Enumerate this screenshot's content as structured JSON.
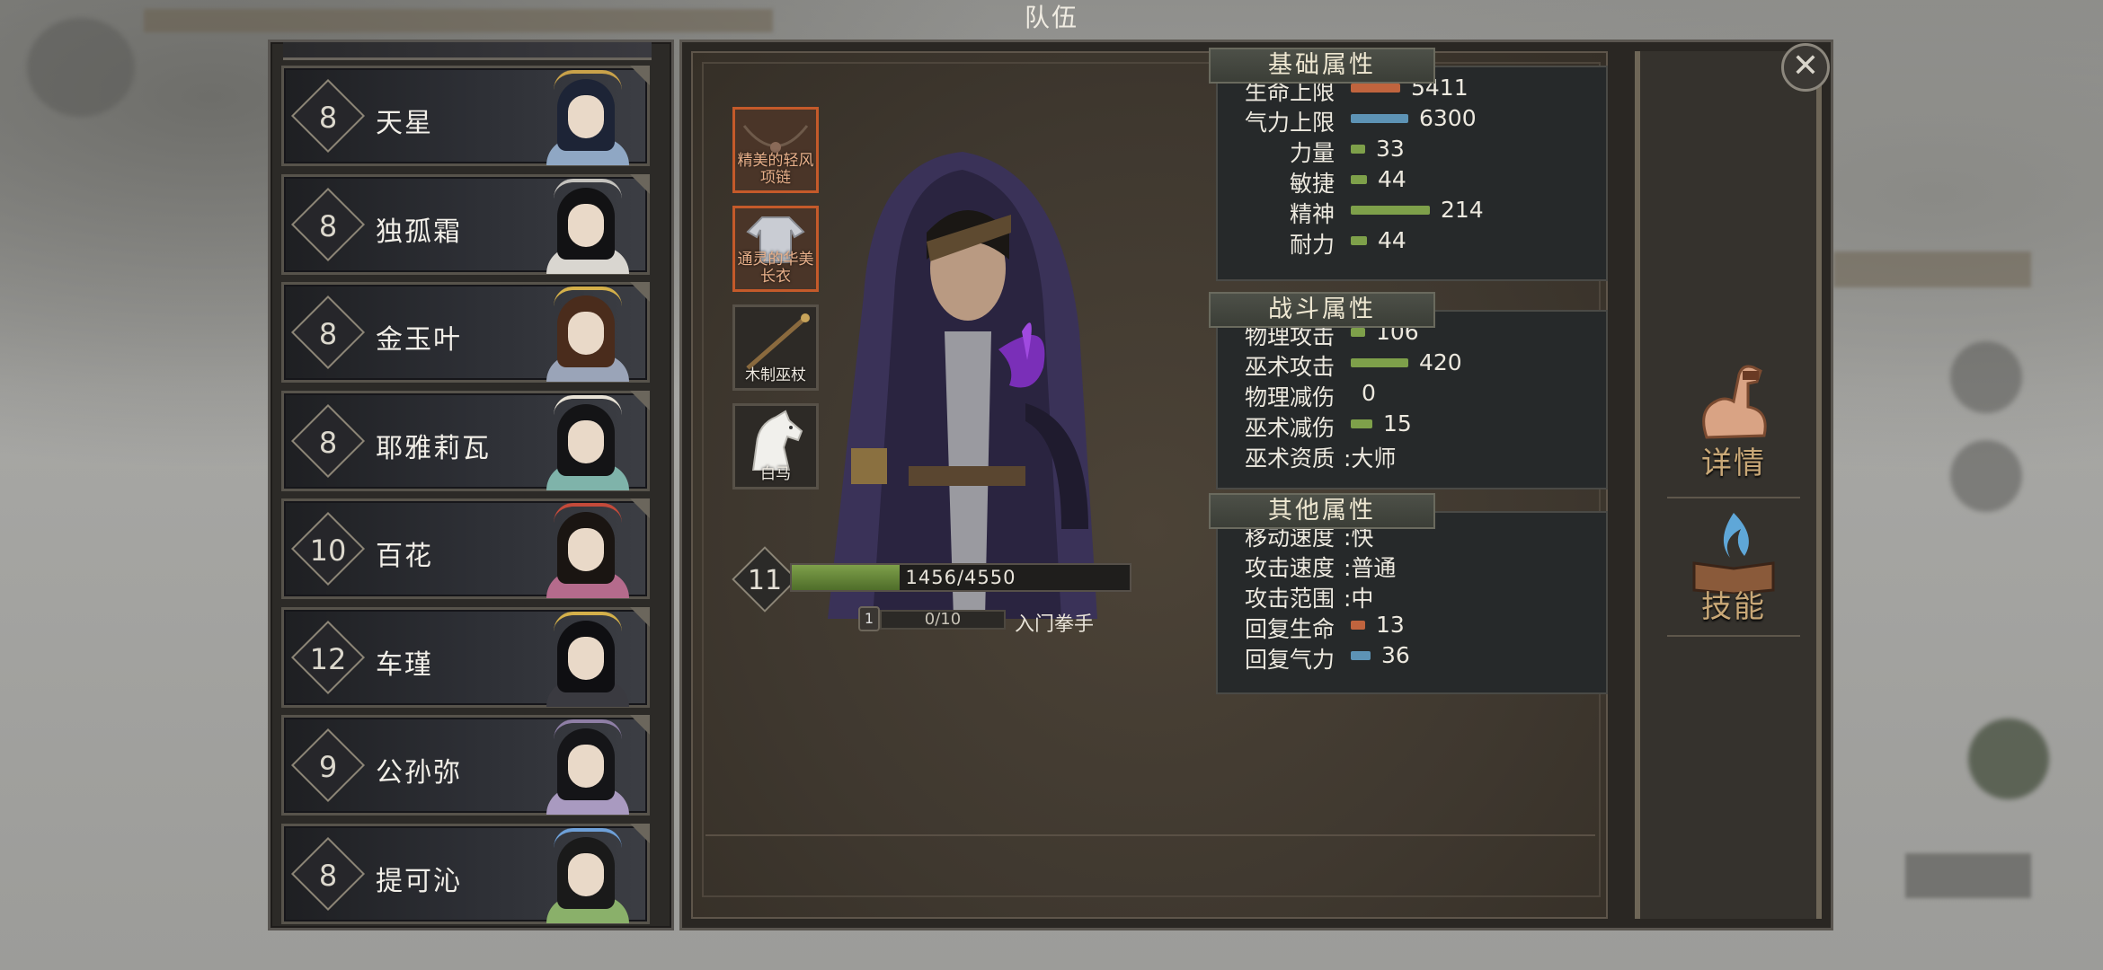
{
  "window": {
    "title": "队伍"
  },
  "roster": [
    {
      "level": "8",
      "name": "天星",
      "hair": "#1d2436",
      "robe": "#8fa7c4",
      "accent": "#c9a24a"
    },
    {
      "level": "8",
      "name": "独孤霜",
      "hair": "#121214",
      "robe": "#d9d6d0",
      "accent": "#c4c2bd"
    },
    {
      "level": "8",
      "name": "金玉叶",
      "hair": "#4a2c1c",
      "robe": "#9aa4b8",
      "accent": "#d4b04a"
    },
    {
      "level": "8",
      "name": "耶雅莉瓦",
      "hair": "#141416",
      "robe": "#7fb3aa",
      "accent": "#e8e2d6"
    },
    {
      "level": "10",
      "name": "百花",
      "hair": "#1a1512",
      "robe": "#b56b8c",
      "accent": "#c44a3a"
    },
    {
      "level": "12",
      "name": "车瑾",
      "hair": "#0f0f12",
      "robe": "#3a3a40",
      "accent": "#d4b04a"
    },
    {
      "level": "9",
      "name": "公孙弥",
      "hair": "#151518",
      "robe": "#a99ac0",
      "accent": "#8f7fa6"
    },
    {
      "level": "8",
      "name": "提可沁",
      "hair": "#1a1a1a",
      "robe": "#8ab06a",
      "accent": "#6ea0d8"
    }
  ],
  "equipment": [
    {
      "label_line1": "精美的轻风",
      "label_line2": "项链",
      "selected": true
    },
    {
      "label_line1": "通灵的华美",
      "label_line2": "长衣",
      "selected": true
    },
    {
      "label_line1": "木制巫杖",
      "label_line2": "",
      "selected": false
    },
    {
      "label_line1": "白马",
      "label_line2": "",
      "selected": false
    }
  ],
  "character": {
    "level": "11",
    "exp_text": "1456/4550",
    "exp_fraction": 0.32,
    "skill_level": "1",
    "skill_exp_text": "0/10",
    "skill_name": "入门拳手"
  },
  "basic_attributes": {
    "title": "基础属性",
    "rows": [
      {
        "label": "生命上限",
        "value": "5411",
        "bar_color": "#c0643e",
        "fill": 0.25
      },
      {
        "label": "气力上限",
        "value": "6300",
        "bar_color": "#5d93b5",
        "fill": 0.29
      },
      {
        "label": "力量",
        "value": "33",
        "bar_color": "#7ea04a",
        "fill": 0.06
      },
      {
        "label": "敏捷",
        "value": "44",
        "bar_color": "#7ea04a",
        "fill": 0.08
      },
      {
        "label": "精神",
        "value": "214",
        "bar_color": "#7ea04a",
        "fill": 0.4
      },
      {
        "label": "耐力",
        "value": "44",
        "bar_color": "#7ea04a",
        "fill": 0.08
      }
    ]
  },
  "combat_attributes": {
    "title": "战斗属性",
    "rows": [
      {
        "label": "物理攻击",
        "value": "106",
        "bar_color": "#7ea04a",
        "fill": 0.06
      },
      {
        "label": "巫术攻击",
        "value": "420",
        "bar_color": "#7ea04a",
        "fill": 0.29
      },
      {
        "label": "物理减伤",
        "value": "0",
        "bar_color": "#7ea04a",
        "fill": 0
      },
      {
        "label": "巫术减伤",
        "value": "15",
        "bar_color": "#7ea04a",
        "fill": 0.11
      },
      {
        "label": "巫术资质",
        "value": ":大师",
        "bar_color": "",
        "fill": -1
      }
    ]
  },
  "other_attributes": {
    "title": "其他属性",
    "rows": [
      {
        "label": "移动速度",
        "value": ":快",
        "bar_color": "",
        "fill": -1
      },
      {
        "label": "攻击速度",
        "value": ":普通",
        "bar_color": "",
        "fill": -1
      },
      {
        "label": "攻击范围",
        "value": ":中",
        "bar_color": "",
        "fill": -1
      },
      {
        "label": "回复生命",
        "value": "13",
        "bar_color": "#c0643e",
        "fill": 0.03
      },
      {
        "label": "回复气力",
        "value": "36",
        "bar_color": "#5d93b5",
        "fill": 0.1
      }
    ]
  },
  "side_buttons": [
    {
      "label": "详情",
      "icon": "muscle-arm-icon"
    },
    {
      "label": "技能",
      "icon": "skill-book-icon"
    }
  ],
  "close_icon": "close-icon"
}
